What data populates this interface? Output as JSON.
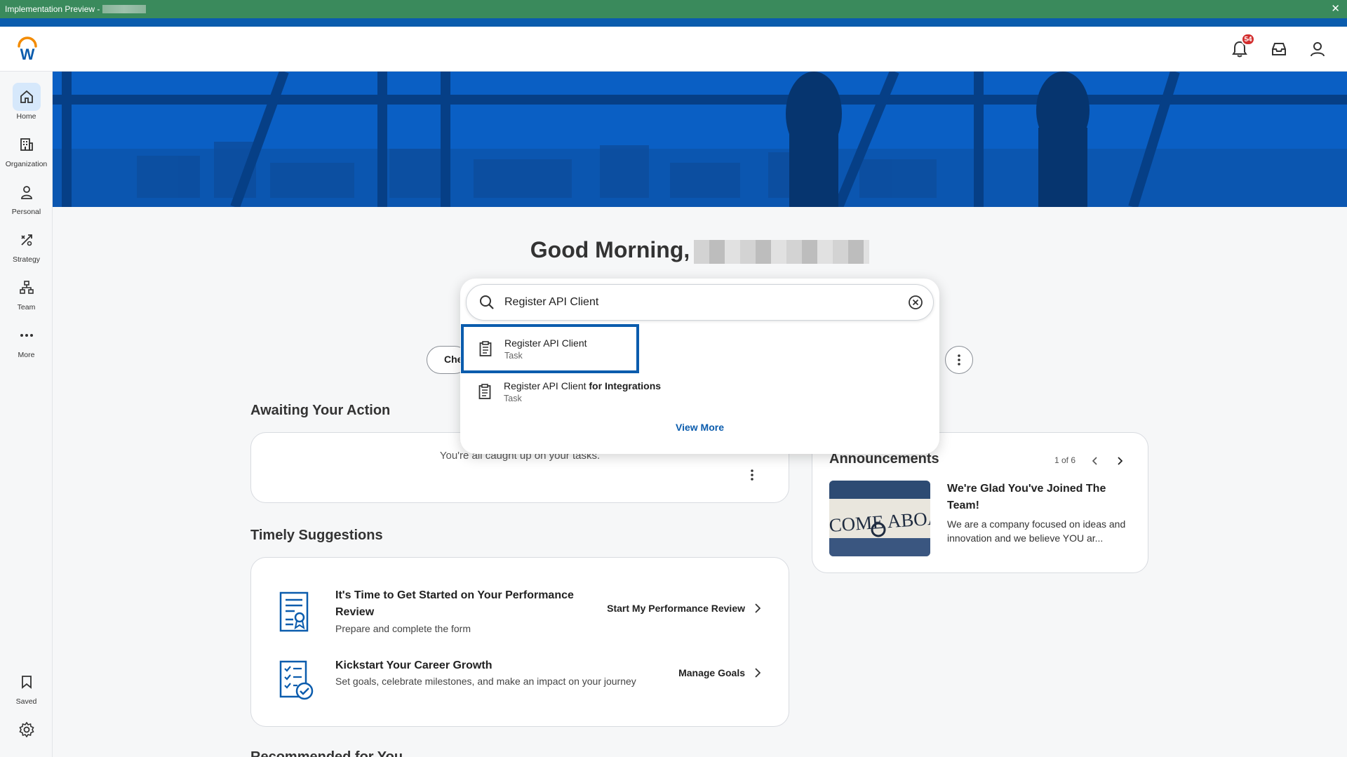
{
  "window": {
    "title": "Implementation Preview -"
  },
  "header": {
    "notification_count": "54"
  },
  "nav": {
    "items": [
      {
        "label": "Home"
      },
      {
        "label": "Organization"
      },
      {
        "label": "Personal"
      },
      {
        "label": "Strategy"
      },
      {
        "label": "Team"
      },
      {
        "label": "More"
      }
    ],
    "bottom": [
      {
        "label": "Saved"
      }
    ]
  },
  "greeting": {
    "text": "Good Morning,"
  },
  "search": {
    "value": "Register API Client",
    "results": [
      {
        "title": "Register API Client",
        "title_bold": "",
        "type": "Task"
      },
      {
        "title": "Register API Client",
        "title_bold": "for Integrations",
        "type": "Task"
      }
    ],
    "view_more": "View More"
  },
  "pill": {
    "label": "Che"
  },
  "awaiting": {
    "title": "Awaiting Your Action",
    "message": "You're all caught up on your tasks."
  },
  "suggestions": {
    "title": "Timely Suggestions",
    "items": [
      {
        "title": "It's Time to Get Started on Your Performance Review",
        "description": "Prepare and complete the form",
        "action": "Start My Performance Review"
      },
      {
        "title": "Kickstart Your Career Growth",
        "description": "Set goals, celebrate milestones, and make an impact on your journey",
        "action": "Manage Goals"
      }
    ]
  },
  "announcements": {
    "title": "Announcements",
    "counter": "1 of 6",
    "headline": "We're Glad You've Joined The Team!",
    "body": "We are a company focused on ideas and innovation and we believe YOU ar...",
    "image_text": "ELCOME ABOAR"
  },
  "recommended": {
    "title": "Recommended for You"
  },
  "colors": {
    "title_bar": "#3a8a5c",
    "brand_blue": "#0b5cad",
    "banner": "#0a5fc4",
    "badge": "#d32f2f"
  }
}
